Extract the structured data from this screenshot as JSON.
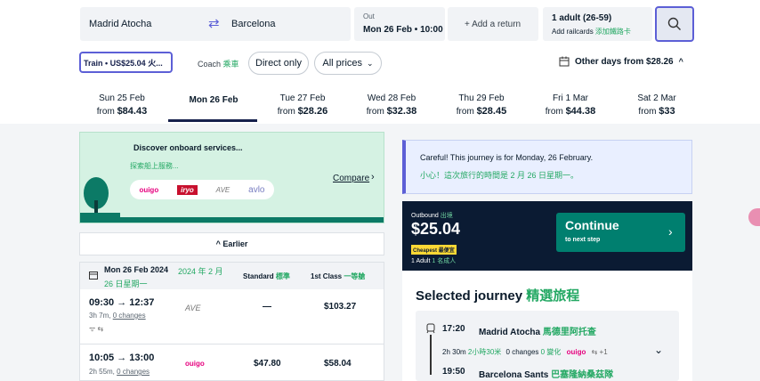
{
  "search": {
    "origin": "Madrid Atocha",
    "destination": "Barcelona",
    "out_label": "Out",
    "out_value": "Mon 26 Feb • 10:00",
    "add_return": "+ Add a return",
    "passengers": "1 adult (26-59)",
    "railcards_en": "Add railcards",
    "railcards_zh": "添加鐵路卡"
  },
  "filters": {
    "train": "Train • US$25.04 火...",
    "coach_en": "Coach",
    "coach_zh": "乘車",
    "direct": "Direct only",
    "prices": "All prices",
    "other_days": "Other days from $28.26"
  },
  "dates": [
    {
      "day": "Sun 25 Feb",
      "from": "from",
      "price": "$84.43"
    },
    {
      "day": "Mon 26 Feb",
      "from": "",
      "price": ""
    },
    {
      "day": "Tue 27 Feb",
      "from": "from",
      "price": "$28.26"
    },
    {
      "day": "Wed 28 Feb",
      "from": "from",
      "price": "$32.38"
    },
    {
      "day": "Thu 29 Feb",
      "from": "from",
      "price": "$28.45"
    },
    {
      "day": "Fri 1 Mar",
      "from": "from",
      "price": "$44.38"
    },
    {
      "day": "Sat 2 Mar",
      "from": "from",
      "price": "$33"
    }
  ],
  "promo": {
    "title": "Discover onboard services...",
    "subtitle": "探索船上服務...",
    "compare": "Compare",
    "brands": [
      "ouigo",
      "iryo",
      "AVE",
      "avlo"
    ]
  },
  "list": {
    "earlier": "Earlier",
    "date_en": "Mon 26 Feb 2024",
    "date_zh1": "2024 年 2 月",
    "date_zh2": "26 日星期一",
    "col_standard": "Standard",
    "col_standard_zh": "標準",
    "col_first": "1st Class",
    "col_first_zh": "一等艙",
    "rows": [
      {
        "time": "09:30 → 12:37",
        "meta": "3h 7m,",
        "changes": "0 changes",
        "brand": "AVE",
        "standard": "—",
        "first": "$103.27"
      },
      {
        "time": "10:05 → 13:00",
        "meta": "2h 55m,",
        "changes": "0 changes",
        "brand": "ouigo",
        "standard": "$47.80",
        "first": "$58.04"
      }
    ]
  },
  "notice": {
    "en": "Careful! This journey is for Monday, 26 February.",
    "zh": "小心！這次旅行的時間是 2 月 26 日星期一。"
  },
  "summary": {
    "outbound": "Outbound",
    "outbound_zh": "出境",
    "price": "$25.04",
    "cheapest": "Cheapest",
    "cheapest_zh": "最便宜",
    "adult": "1 Adult",
    "adult_zh": "1 名成人",
    "continue": "Continue",
    "continue_sub": "to next step"
  },
  "journey": {
    "title": "Selected journey",
    "title_zh": "精選旅程",
    "dep_time": "17:20",
    "dep_station": "Madrid Atocha",
    "dep_zh": "馬德里阿托查",
    "duration": "2h 30m",
    "duration_zh": "2小時30米",
    "changes": "0 changes",
    "changes_zh": "0 變化",
    "brand": "ouigo",
    "extra": "+1",
    "arr_time": "19:50",
    "arr_station": "Barcelona Sants",
    "arr_zh": "巴塞隆納桑茲隊"
  },
  "colors": {
    "accent": "#5c5fd6",
    "dark": "#0b1b33",
    "green": "#007f6f",
    "notice": "#e9efff"
  }
}
